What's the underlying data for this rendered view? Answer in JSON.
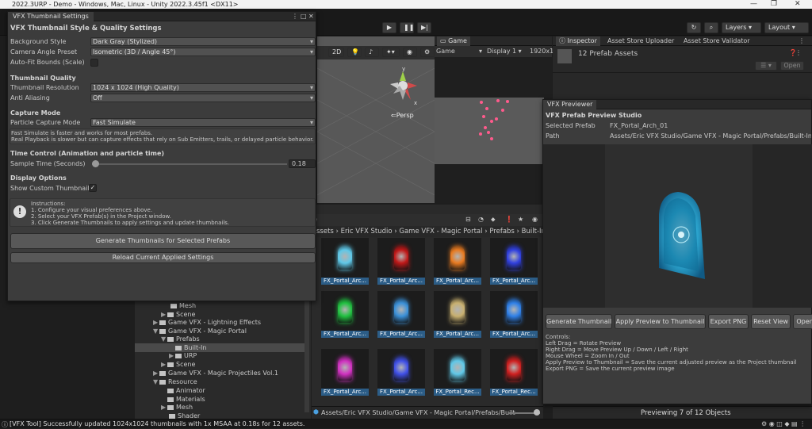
{
  "window": {
    "title": "2022.3URP - Demo - Windows, Mac, Linux - Unity 2022.3.45f1 <DX11>"
  },
  "toolbar": {
    "layers_label": "Layers",
    "layout_label": "Layout"
  },
  "scene": {
    "mode_2d": "2D",
    "persp_label": "Persp"
  },
  "game": {
    "tab_label": "Game",
    "display_mode": "Game",
    "display": "Display 1",
    "resolution": "1920x1"
  },
  "inspector": {
    "tabs": [
      "Inspector",
      "Asset Store Uploader",
      "Asset Store Validator"
    ],
    "header": "12 Prefab Assets",
    "open_label": "Open"
  },
  "vfx_tool": {
    "tab_title": "VFX Thumbnail Settings",
    "header": "VFX Thumbnail Style & Quality Settings",
    "background_style": {
      "label": "Background Style",
      "value": "Dark Gray (Stylized)"
    },
    "camera_angle": {
      "label": "Camera Angle Preset",
      "value": "Isometric (3D / Angle 45°)"
    },
    "auto_fit": {
      "label": "Auto-Fit Bounds (Scale)"
    },
    "quality_header": "Thumbnail Quality",
    "resolution": {
      "label": "Thumbnail Resolution",
      "value": "1024 x 1024 (High Quality)"
    },
    "anti_aliasing": {
      "label": "Anti Aliasing",
      "value": "Off"
    },
    "capture_header": "Capture Mode",
    "capture_mode": {
      "label": "Particle Capture Mode",
      "value": "Fast Simulate"
    },
    "capture_note_1": "Fast Simulate is faster and works for most prefabs.",
    "capture_note_2": "Real Playback is slower but can capture effects that rely on Sub Emitters, trails, or delayed particle behavior.",
    "time_header": "Time Control (Animation and particle time)",
    "sample_time": {
      "label": "Sample Time (Seconds)",
      "value": "0.18",
      "fraction": 0.0
    },
    "display_header": "Display Options",
    "show_custom": {
      "label": "Show Custom Thumbnails"
    },
    "instructions": [
      "Instructions:",
      "1. Configure your visual preferences above.",
      "2. Select your VFX Prefab(s) in the Project window.",
      "3. Click Generate Thumbnails to apply settings and update thumbnails."
    ],
    "generate_button": "Generate Thumbnails for Selected Prefabs",
    "reload_button": "Reload Current Applied Settings"
  },
  "previewer": {
    "tab_title": "VFX Previewer",
    "header": "VFX Prefab Preview Studio",
    "selected_label": "Selected Prefab",
    "selected_value": "FX_Portal_Arch_01",
    "path_label": "Path",
    "path_value": "Assets/Eric VFX Studio/Game VFX - Magic Portal/Prefabs/Built-In/P",
    "buttons": [
      "Generate Thumbnail",
      "Apply Preview to Thumbnail",
      "Export PNG",
      "Reset View",
      "Open"
    ],
    "controls": [
      "Controls:",
      "Left Drag = Rotate Preview",
      "Right Drag = Move Preview Up / Down / Left / Right",
      "Mouse Wheel = Zoom In / Out",
      "Apply Preview to Thumbnail = Save the current adjusted preview as the Project thumbnail",
      "Export PNG = Save the current preview image"
    ]
  },
  "project": {
    "breadcrumb": [
      "ssets",
      "Eric VFX Studio",
      "Game VFX - Magic Portal",
      "Prefabs",
      "Built-In"
    ],
    "footer_path": "Assets/Eric VFX Studio/Game VFX - Magic Portal/Prefabs/Built-",
    "items": [
      {
        "name": "FX_Portal_Arc...",
        "color": "#5fc8e8"
      },
      {
        "name": "FX_Portal_Arc...",
        "color": "#c01818"
      },
      {
        "name": "FX_Portal_Arc...",
        "color": "#e87a20"
      },
      {
        "name": "FX_Portal_Arc...",
        "color": "#3040e0"
      },
      {
        "name": "FX_Portal_Arc...",
        "color": "#20c040"
      },
      {
        "name": "FX_Portal_Arc...",
        "color": "#3a90d8"
      },
      {
        "name": "FX_Portal_Arc...",
        "color": "#c8b070"
      },
      {
        "name": "FX_Portal_Arc...",
        "color": "#2f80e8"
      },
      {
        "name": "FX_Portal_Arc...",
        "color": "#d030c0"
      },
      {
        "name": "FX_Portal_Arc...",
        "color": "#4050e8"
      },
      {
        "name": "FX_Portal_Rec...",
        "color": "#60c8e8"
      },
      {
        "name": "FX_Portal_Rec...",
        "color": "#d02020"
      }
    ],
    "tree": [
      "Mesh",
      "Scene",
      "Game VFX - Lightning Effects",
      "Game VFX - Magic Portal",
      "Prefabs",
      "Built-In",
      "URP",
      "Scene",
      "Game VFX - Magic Projectiles Vol.1",
      "Resource",
      "Animator",
      "Materials",
      "Mesh",
      "Shader"
    ]
  },
  "inspector_footer": "Previewing 7 of 12 Objects",
  "status_text": "[VFX Tool] Successfully updated 1024x1024 thumbnails with 1x MSAA at 0.18s for 12 assets."
}
